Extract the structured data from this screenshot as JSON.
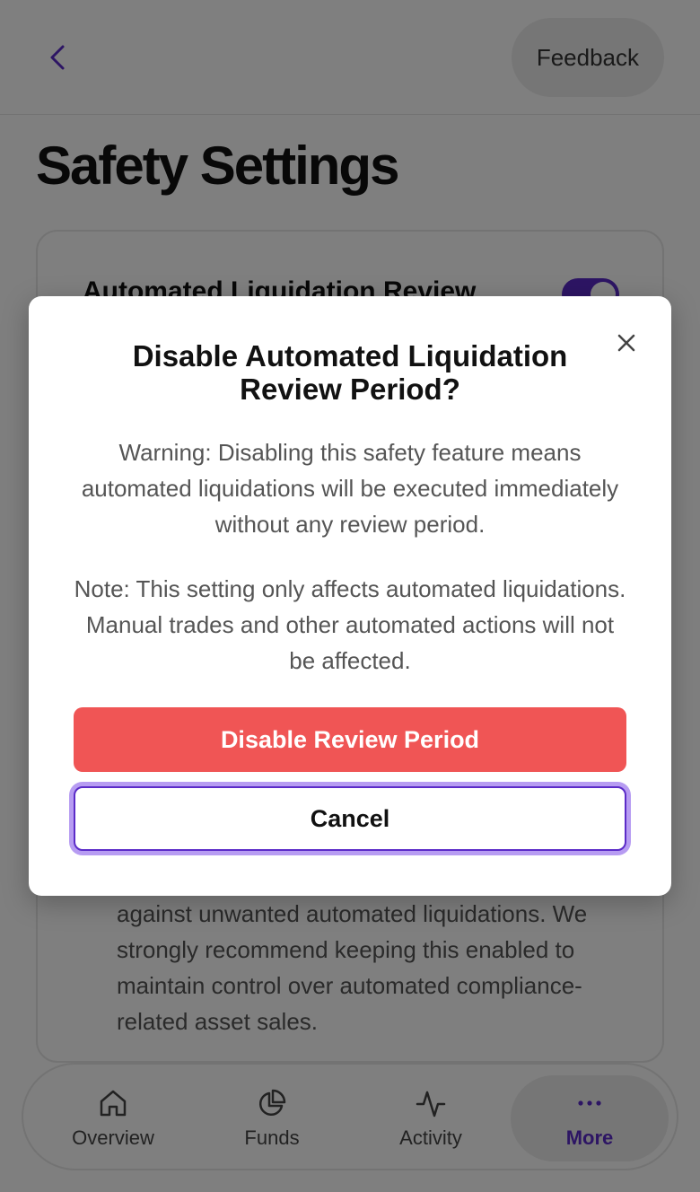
{
  "header": {
    "feedback_label": "Feedback"
  },
  "page": {
    "title": "Safety Settings"
  },
  "card": {
    "title": "Automated Liquidation Review",
    "toggle_on": true,
    "description": "against unwanted automated liquidations. We strongly recommend keeping this enabled to maintain control over automated compliance-related asset sales."
  },
  "nav": {
    "items": [
      {
        "label": "Overview",
        "icon": "home-icon"
      },
      {
        "label": "Funds",
        "icon": "pie-chart-icon"
      },
      {
        "label": "Activity",
        "icon": "activity-icon"
      },
      {
        "label": "More",
        "icon": "more-icon",
        "active": true
      }
    ]
  },
  "modal": {
    "title": "Disable Automated Liquidation Review Period?",
    "warning": "Warning: Disabling this safety feature means automated liquidations will be executed immediately without any review period.",
    "note": "Note: This setting only affects automated liquidations. Manual trades and other automated actions will not be affected.",
    "confirm_label": "Disable Review Period",
    "cancel_label": "Cancel"
  },
  "colors": {
    "accent": "#5b2bc8",
    "danger": "#f05555",
    "focus_ring": "#b79cf2"
  }
}
